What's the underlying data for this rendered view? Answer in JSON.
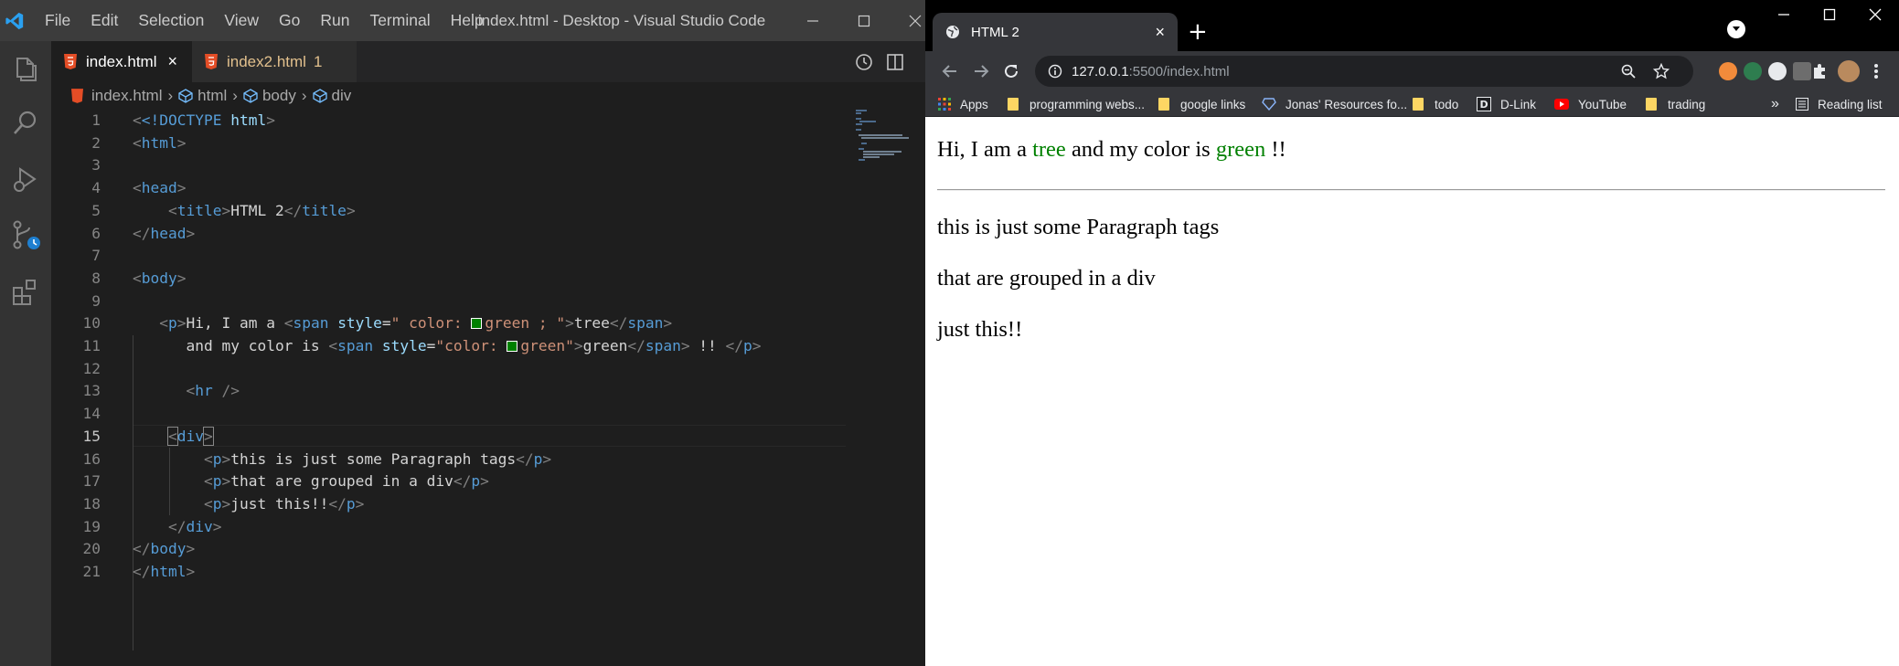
{
  "vscode": {
    "menu": [
      "File",
      "Edit",
      "Selection",
      "View",
      "Go",
      "Run",
      "Terminal",
      "Help"
    ],
    "window_title": "index.html - Desktop - Visual Studio Code",
    "tabs": [
      {
        "label": "index.html",
        "close": "×"
      },
      {
        "label": "index2.html",
        "badge": "1"
      }
    ],
    "breadcrumb": [
      "index.html",
      "html",
      "body",
      "div"
    ],
    "lines": [
      "1",
      "2",
      "3",
      "4",
      "5",
      "6",
      "7",
      "8",
      "9",
      "10",
      "11",
      "12",
      "13",
      "14",
      "15",
      "16",
      "17",
      "18",
      "19",
      "20",
      "21"
    ],
    "active_line": "15",
    "code": {
      "l1_doctype": "<!DOCTYPE",
      "l1_html": "html",
      "l1_end": ">",
      "tag_html": "html",
      "tag_head": "head",
      "tag_title": "title",
      "title_text": "HTML 2",
      "tag_body": "body",
      "tag_p": "p",
      "tag_span": "span",
      "attr_style": "style",
      "l10_text": "Hi, I am a ",
      "l10_style_a": "\" color: ",
      "l10_style_b": "green ; \"",
      "l10_inner": "tree",
      "l11_text": "and my color is ",
      "l11_style_a": "\"color: ",
      "l11_style_b": "green\"",
      "l11_inner": "green",
      "l11_after": " !! ",
      "tag_hr": "hr",
      "tag_div": "div",
      "p1": "this is just some Paragraph tags",
      "p2": "that are grouped in a div",
      "p3": "just this!!"
    }
  },
  "chrome": {
    "tab_title": "HTML 2",
    "tab_close": "×",
    "new_tab": "+",
    "url_host": "127.0.0.1",
    "url_path": ":5500/index.html",
    "bookmarks": [
      "Apps",
      "programming webs...",
      "google links",
      "Jonas' Resources fo...",
      "todo",
      "D-Link",
      "YouTube",
      "trading"
    ],
    "more_bookmarks": "»",
    "reading_list": "Reading list"
  },
  "page": {
    "line1_a": "Hi, I am a ",
    "line1_tree": "tree",
    "line1_b": " and my color is ",
    "line1_green": "green",
    "line1_c": " !!",
    "p1": "this is just some Paragraph tags",
    "p2": "that are grouped in a div",
    "p3": "just this!!"
  },
  "colors": {
    "vscode_titlebar": "#3c3c3c",
    "vscode_editor": "#1e1e1e",
    "vscode_tag": "#569cd6",
    "vscode_attr": "#9cdcfe",
    "vscode_string": "#ce9178",
    "chrome_toolbar": "#35363a",
    "span_green": "#008000"
  },
  "icons": [
    "vscode-logo-icon",
    "explorer-icon",
    "search-icon",
    "run-debug-icon",
    "source-control-icon",
    "extensions-icon",
    "html5-icon",
    "history-icon",
    "split-editor-icon",
    "globe-icon",
    "back-icon",
    "forward-icon",
    "reload-icon",
    "info-icon",
    "zoom-icon",
    "star-icon",
    "extensions-puzzle-icon",
    "menu-dots-icon",
    "folder-icon",
    "youtube-icon"
  ]
}
